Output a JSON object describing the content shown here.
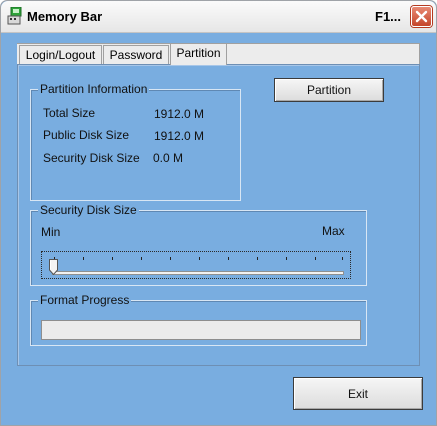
{
  "window": {
    "title": "Memory Bar",
    "title_right": "F1..."
  },
  "tabs": [
    {
      "label": "Login/Logout",
      "active": false
    },
    {
      "label": "Password",
      "active": false
    },
    {
      "label": "Partition",
      "active": true
    }
  ],
  "partition_info": {
    "group_label": "Partition Information",
    "rows": [
      {
        "label": "Total Size",
        "value": "1912.0 M"
      },
      {
        "label": "Public Disk Size",
        "value": "1912.0 M"
      },
      {
        "label": "Security Disk Size",
        "value": "0.0 M"
      }
    ]
  },
  "partition_button": {
    "label": "Partition"
  },
  "security_slider": {
    "group_label": "Security Disk Size",
    "min_label": "Min",
    "max_label": "Max",
    "value": 0
  },
  "format_progress": {
    "group_label": "Format Progress",
    "value": 0
  },
  "exit_button": {
    "label": "Exit"
  },
  "colors": {
    "window_bg": "#79ade0",
    "titlebar": "#eeeeee",
    "close_button": "#d0543a"
  },
  "icons": {
    "app": "memory-bar-app-icon",
    "close": "close-x-icon",
    "slider_thumb": "slider-thumb-icon"
  }
}
